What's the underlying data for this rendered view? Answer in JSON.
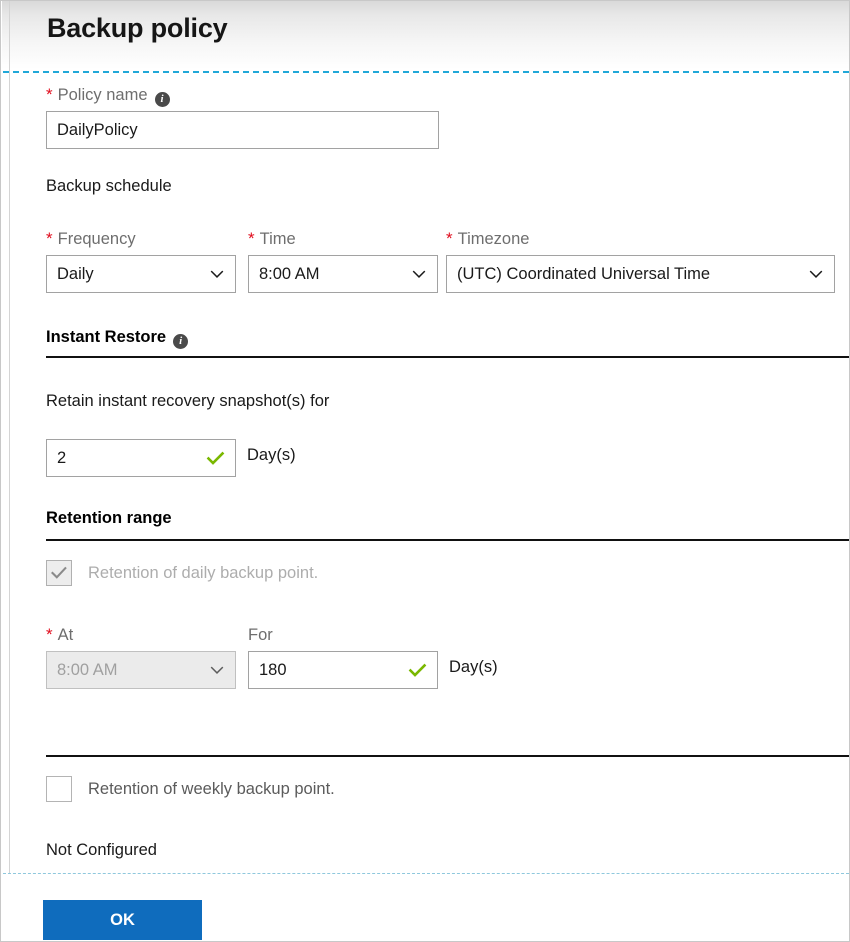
{
  "blade": {
    "title": "Backup policy"
  },
  "policy_name": {
    "label": "Policy name",
    "required_marker": "*",
    "info_icon": "info-icon",
    "info_glyph": "i",
    "value": "DailyPolicy"
  },
  "backup_schedule": {
    "heading": "Backup schedule",
    "frequency": {
      "label": "Frequency",
      "required_marker": "*",
      "value": "Daily",
      "icon": "chevron-down-icon"
    },
    "time": {
      "label": "Time",
      "required_marker": "*",
      "value": "8:00 AM",
      "icon": "chevron-down-icon"
    },
    "timezone": {
      "label": "Timezone",
      "required_marker": "*",
      "value": "(UTC) Coordinated Universal Time",
      "icon": "chevron-down-icon"
    }
  },
  "instant_restore": {
    "heading": "Instant Restore",
    "info_icon": "info-icon",
    "info_glyph": "i",
    "retain_label": "Retain instant recovery snapshot(s) for",
    "days_value": "2",
    "days_unit": "Day(s)",
    "validation_icon": "green-check-icon"
  },
  "retention_range": {
    "heading": "Retention range",
    "daily": {
      "checkbox_state": "checked-disabled",
      "label": "Retention of daily backup point.",
      "at": {
        "label": "At",
        "required_marker": "*",
        "value": "8:00 AM",
        "icon": "chevron-down-icon",
        "disabled": true
      },
      "for": {
        "label": "For",
        "value": "180",
        "unit": "Day(s)",
        "validation_icon": "green-check-icon"
      }
    },
    "weekly": {
      "checkbox_state": "unchecked",
      "label": "Retention of weekly backup point.",
      "status": "Not Configured"
    }
  },
  "footer": {
    "ok_label": "OK"
  },
  "colors": {
    "accent_blue": "#0f6cbd",
    "required_red": "#e00b1c",
    "validation_green": "#7ab800",
    "dashed_separator": "#21a8d8"
  }
}
